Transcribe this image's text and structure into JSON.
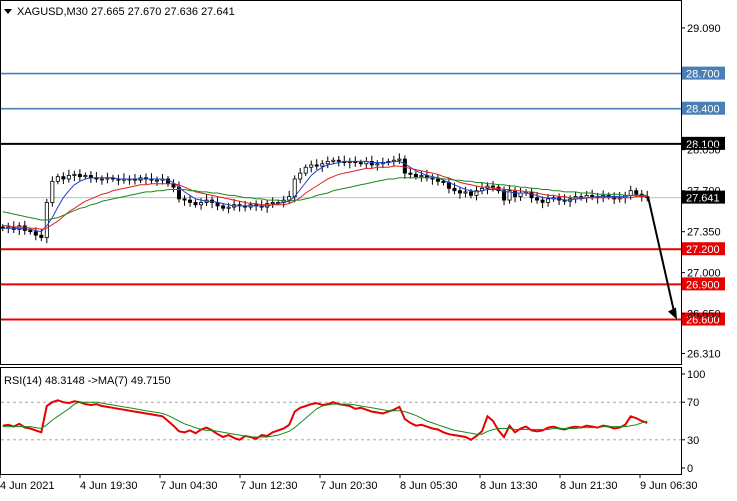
{
  "header": {
    "symbol_line": "XAGUSD,M30  27.665 27.670 27.636 27.641"
  },
  "rsi_header": "RSI(14) 48.3148  ->MA(7) 49.7150",
  "colors": {
    "bull_bear_candle": "#000000",
    "ma_fast": "#1f3fd6",
    "ma_mid": "#e02020",
    "ma_slow": "#1a8a1a",
    "level_blue": "#4a7fb5",
    "level_black": "#000000",
    "level_red": "#e60000",
    "rsi_line": "#e60000",
    "rsi_ma": "#1a8a1a",
    "arrow": "#000000"
  },
  "chart_data": [
    {
      "type": "line",
      "panel": "price",
      "instrument": "XAGUSD",
      "timeframe": "M30",
      "ohlc_last": {
        "open": 27.665,
        "high": 27.67,
        "low": 27.636,
        "close": 27.641
      },
      "current_price": "27.641",
      "ylim": [
        26.22,
        29.32
      ],
      "y_ticks": [
        "29.090",
        "28.700",
        "28.400",
        "28.100",
        "28.050",
        "27.700",
        "27.350",
        "27.200",
        "27.000",
        "26.900",
        "26.650",
        "26.600",
        "26.310"
      ],
      "levels": [
        {
          "value": 28.7,
          "label": "28.700",
          "color": "#4a7fb5",
          "label_bg": "#4a7fb5"
        },
        {
          "value": 28.4,
          "label": "28.400",
          "color": "#4a7fb5",
          "label_bg": "#4a7fb5"
        },
        {
          "value": 28.1,
          "label": "28.100",
          "color": "#000000",
          "label_bg": "#000000"
        },
        {
          "value": 27.2,
          "label": "27.200",
          "color": "#e60000",
          "label_bg": "#e60000"
        },
        {
          "value": 26.9,
          "label": "26.900",
          "color": "#e60000",
          "label_bg": "#e60000"
        },
        {
          "value": 26.6,
          "label": "26.600",
          "color": "#e60000",
          "label_bg": "#e60000"
        }
      ],
      "candles_close": [
        27.38,
        27.39,
        27.37,
        27.4,
        27.36,
        27.35,
        27.32,
        27.3,
        27.6,
        27.78,
        27.82,
        27.8,
        27.83,
        27.84,
        27.82,
        27.83,
        27.81,
        27.8,
        27.8,
        27.81,
        27.8,
        27.79,
        27.8,
        27.8,
        27.79,
        27.81,
        27.8,
        27.79,
        27.79,
        27.8,
        27.76,
        27.73,
        27.63,
        27.62,
        27.6,
        27.58,
        27.6,
        27.62,
        27.6,
        27.57,
        27.55,
        27.56,
        27.58,
        27.57,
        27.56,
        27.58,
        27.57,
        27.56,
        27.59,
        27.6,
        27.6,
        27.62,
        27.65,
        27.8,
        27.85,
        27.9,
        27.92,
        27.91,
        27.93,
        27.95,
        27.96,
        27.95,
        27.94,
        27.95,
        27.94,
        27.93,
        27.95,
        27.92,
        27.93,
        27.94,
        27.95,
        27.96,
        27.97,
        27.85,
        27.84,
        27.82,
        27.83,
        27.81,
        27.8,
        27.78,
        27.77,
        27.72,
        27.7,
        27.68,
        27.69,
        27.66,
        27.7,
        27.72,
        27.74,
        27.73,
        27.7,
        27.62,
        27.7,
        27.65,
        27.68,
        27.69,
        27.64,
        27.62,
        27.6,
        27.63,
        27.64,
        27.62,
        27.61,
        27.63,
        27.65,
        27.64,
        27.66,
        27.65,
        27.64,
        27.66,
        27.65,
        27.63,
        27.64,
        27.66,
        27.7,
        27.67,
        27.65,
        27.64
      ],
      "series": [
        {
          "name": "",
          "color": "#1f3fd6",
          "values": [
            27.38,
            27.38,
            27.38,
            27.38,
            27.37,
            27.37,
            27.36,
            27.35,
            27.4,
            27.47,
            27.56,
            27.64,
            27.7,
            27.75,
            27.78,
            27.8,
            27.81,
            27.81,
            27.81,
            27.81,
            27.81,
            27.8,
            27.8,
            27.8,
            27.8,
            27.8,
            27.8,
            27.8,
            27.8,
            27.8,
            27.79,
            27.77,
            27.73,
            27.69,
            27.66,
            27.63,
            27.62,
            27.61,
            27.61,
            27.6,
            27.59,
            27.58,
            27.57,
            27.57,
            27.57,
            27.57,
            27.57,
            27.57,
            27.57,
            27.58,
            27.59,
            27.6,
            27.61,
            27.65,
            27.71,
            27.77,
            27.83,
            27.87,
            27.9,
            27.92,
            27.93,
            27.94,
            27.95,
            27.95,
            27.95,
            27.95,
            27.95,
            27.94,
            27.94,
            27.94,
            27.94,
            27.95,
            27.95,
            27.93,
            27.9,
            27.87,
            27.85,
            27.83,
            27.82,
            27.81,
            27.79,
            27.77,
            27.75,
            27.73,
            27.71,
            27.7,
            27.69,
            27.7,
            27.71,
            27.71,
            27.71,
            27.69,
            27.69,
            27.68,
            27.68,
            27.68,
            27.67,
            27.66,
            27.64,
            27.64,
            27.63,
            27.63,
            27.62,
            27.62,
            27.63,
            27.63,
            27.64,
            27.64,
            27.65,
            27.65,
            27.65,
            27.65,
            27.65,
            27.65,
            27.66,
            27.66,
            27.66,
            27.65
          ]
        },
        {
          "name": "",
          "color": "#e02020",
          "values": [
            27.4,
            27.4,
            27.39,
            27.39,
            27.39,
            27.38,
            27.38,
            27.37,
            27.38,
            27.41,
            27.44,
            27.48,
            27.52,
            27.55,
            27.58,
            27.61,
            27.63,
            27.65,
            27.67,
            27.68,
            27.7,
            27.71,
            27.72,
            27.73,
            27.74,
            27.75,
            27.75,
            27.76,
            27.76,
            27.76,
            27.76,
            27.76,
            27.75,
            27.73,
            27.71,
            27.69,
            27.68,
            27.67,
            27.66,
            27.65,
            27.64,
            27.63,
            27.62,
            27.61,
            27.6,
            27.59,
            27.59,
            27.58,
            27.58,
            27.58,
            27.58,
            27.58,
            27.59,
            27.61,
            27.64,
            27.68,
            27.71,
            27.74,
            27.77,
            27.8,
            27.82,
            27.84,
            27.85,
            27.86,
            27.87,
            27.88,
            27.89,
            27.89,
            27.9,
            27.9,
            27.9,
            27.91,
            27.91,
            27.9,
            27.89,
            27.88,
            27.87,
            27.86,
            27.85,
            27.84,
            27.82,
            27.81,
            27.79,
            27.77,
            27.76,
            27.75,
            27.74,
            27.73,
            27.73,
            27.72,
            27.72,
            27.71,
            27.71,
            27.7,
            27.7,
            27.69,
            27.69,
            27.68,
            27.67,
            27.66,
            27.66,
            27.65,
            27.65,
            27.64,
            27.64,
            27.64,
            27.64,
            27.64,
            27.64,
            27.64,
            27.64,
            27.64,
            27.64,
            27.64,
            27.64,
            27.65,
            27.65,
            27.65
          ]
        },
        {
          "name": "",
          "color": "#1a8a1a",
          "values": [
            27.52,
            27.51,
            27.5,
            27.49,
            27.48,
            27.47,
            27.46,
            27.45,
            27.45,
            27.46,
            27.47,
            27.49,
            27.51,
            27.53,
            27.55,
            27.56,
            27.58,
            27.59,
            27.61,
            27.62,
            27.63,
            27.64,
            27.65,
            27.66,
            27.67,
            27.68,
            27.69,
            27.69,
            27.7,
            27.7,
            27.71,
            27.71,
            27.71,
            27.71,
            27.7,
            27.7,
            27.69,
            27.69,
            27.68,
            27.68,
            27.67,
            27.66,
            27.66,
            27.65,
            27.64,
            27.64,
            27.63,
            27.63,
            27.62,
            27.62,
            27.62,
            27.61,
            27.61,
            27.62,
            27.62,
            27.63,
            27.64,
            27.66,
            27.67,
            27.68,
            27.7,
            27.71,
            27.72,
            27.73,
            27.74,
            27.75,
            27.76,
            27.77,
            27.78,
            27.79,
            27.8,
            27.8,
            27.81,
            27.81,
            27.81,
            27.81,
            27.81,
            27.81,
            27.81,
            27.81,
            27.8,
            27.8,
            27.79,
            27.79,
            27.78,
            27.78,
            27.77,
            27.77,
            27.76,
            27.76,
            27.75,
            27.75,
            27.74,
            27.74,
            27.73,
            27.73,
            27.72,
            27.72,
            27.71,
            27.71,
            27.7,
            27.7,
            27.69,
            27.69,
            27.69,
            27.68,
            27.68,
            27.68,
            27.67,
            27.67,
            27.67,
            27.67,
            27.67,
            27.66,
            27.66,
            27.66,
            27.66,
            27.66
          ]
        }
      ],
      "projection": {
        "from": 27.641,
        "to": 26.6
      }
    },
    {
      "type": "line",
      "panel": "rsi",
      "ylim": [
        0,
        100
      ],
      "y_ticks": [
        "100",
        "70",
        "30",
        "0"
      ],
      "levels": [
        70,
        30
      ],
      "series": [
        {
          "name": "RSI(14)",
          "color": "#e60000",
          "values": [
            45,
            46,
            44,
            47,
            43,
            42,
            40,
            38,
            66,
            70,
            72,
            70,
            69,
            71,
            70,
            68,
            67,
            68,
            66,
            65,
            64,
            63,
            62,
            61,
            60,
            59,
            58,
            57,
            56,
            55,
            50,
            45,
            39,
            38,
            40,
            37,
            41,
            43,
            40,
            36,
            33,
            35,
            32,
            30,
            34,
            33,
            31,
            35,
            34,
            38,
            40,
            42,
            46,
            60,
            64,
            66,
            68,
            69,
            67,
            68,
            70,
            68,
            67,
            66,
            63,
            64,
            62,
            60,
            59,
            58,
            60,
            62,
            65,
            52,
            48,
            45,
            46,
            44,
            42,
            41,
            38,
            36,
            35,
            34,
            33,
            30,
            34,
            39,
            55,
            50,
            40,
            33,
            45,
            38,
            42,
            44,
            40,
            39,
            40,
            43,
            44,
            42,
            41,
            43,
            44,
            43,
            45,
            44,
            43,
            45,
            44,
            42,
            43,
            46,
            55,
            53,
            50,
            48
          ]
        },
        {
          "name": "MA(7)",
          "color": "#1a8a1a",
          "values": [
            44,
            44,
            44,
            44,
            44,
            44,
            43,
            42,
            46,
            51,
            55,
            59,
            63,
            68,
            70,
            70,
            70,
            70,
            69,
            68,
            67,
            66,
            65,
            64,
            63,
            62,
            61,
            60,
            59,
            58,
            56,
            53,
            50,
            47,
            45,
            43,
            41,
            40,
            40,
            39,
            38,
            37,
            36,
            35,
            34,
            33,
            33,
            33,
            33,
            34,
            35,
            37,
            39,
            43,
            48,
            53,
            58,
            63,
            66,
            67,
            68,
            68,
            68,
            68,
            67,
            66,
            65,
            64,
            63,
            62,
            61,
            61,
            61,
            60,
            58,
            56,
            53,
            50,
            48,
            46,
            44,
            42,
            40,
            39,
            38,
            37,
            36,
            36,
            39,
            41,
            42,
            42,
            42,
            41,
            41,
            41,
            41,
            41,
            41,
            41,
            42,
            42,
            42,
            42,
            42,
            43,
            43,
            43,
            43,
            44,
            44,
            44,
            44,
            44,
            45,
            46,
            48,
            50
          ]
        }
      ]
    }
  ],
  "x_ticks": [
    "4 Jun 2021",
    "4 Jun 19:30",
    "7 Jun 04:30",
    "7 Jun 12:30",
    "7 Jun 20:30",
    "8 Jun 05:30",
    "8 Jun 13:30",
    "8 Jun 21:30",
    "9 Jun 06:30"
  ]
}
